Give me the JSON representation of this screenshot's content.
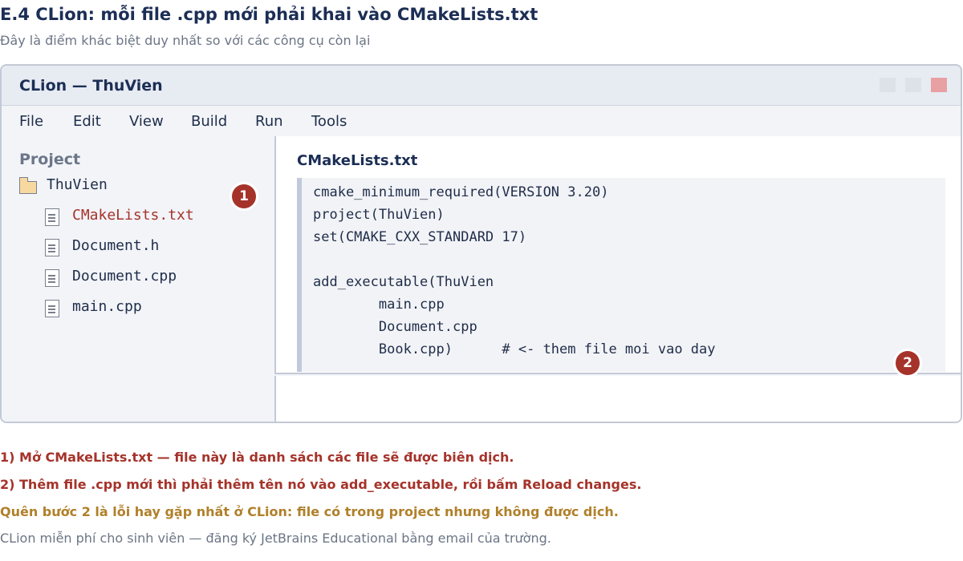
{
  "page": {
    "title": "E.4  CLion: mỗi file .cpp mới phải khai vào CMakeLists.txt",
    "subtitle": "Đây là điểm khác biệt duy nhất so với các công cụ còn lại"
  },
  "window": {
    "title": "CLion — ThuVien"
  },
  "menu": {
    "items": [
      "File",
      "Edit",
      "View",
      "Build",
      "Run",
      "Tools"
    ]
  },
  "sidebar": {
    "title": "Project",
    "folder": "ThuVien",
    "files": [
      "CMakeLists.txt",
      "Document.h",
      "Document.cpp",
      "main.cpp"
    ],
    "active_file": "CMakeLists.txt"
  },
  "editor": {
    "title": "CMakeLists.txt",
    "lines": [
      "cmake_minimum_required(VERSION 3.20)",
      "project(ThuVien)",
      "set(CMAKE_CXX_STANDARD 17)",
      "",
      "add_executable(ThuVien",
      "        main.cpp",
      "        Document.cpp",
      "        Book.cpp)      # <- them file moi vao day"
    ]
  },
  "badges": [
    "1",
    "2"
  ],
  "notes": {
    "step1": "1)  Mở CMakeLists.txt — file này là danh sách các file sẽ được biên dịch.",
    "step2": "2)  Thêm file .cpp mới thì phải thêm tên nó vào add_executable, rồi bấm Reload changes.",
    "warning": "Quên bước 2 là lỗi hay gặp nhất ở CLion: file có trong project nhưng không được dịch.",
    "tip": "CLion miễn phí cho sinh viên — đăng ký JetBrains Educational bằng email của trường."
  },
  "colors": {
    "accent_red": "#a5332a",
    "warning_gold": "#b0802a",
    "navy": "#1c2e55",
    "folder_fill": "#f7d9a0",
    "close_button": "#e8a0a3"
  }
}
